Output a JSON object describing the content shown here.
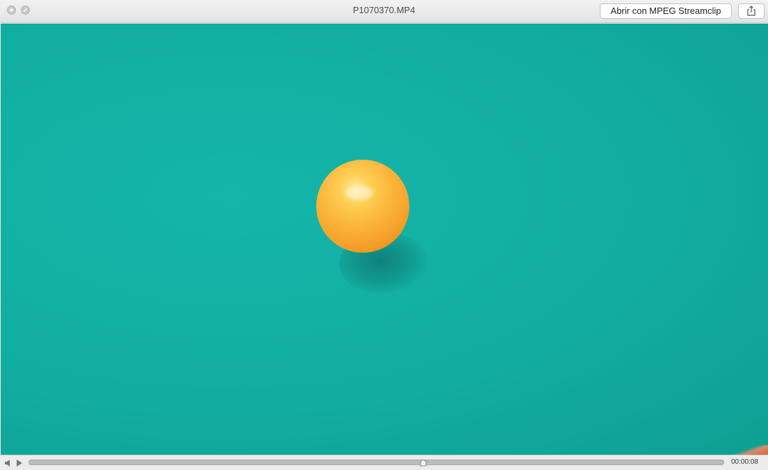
{
  "window": {
    "title": "P1070370.MP4"
  },
  "toolbar": {
    "open_with_label": "Abrir con MPEG Streamclip",
    "share_icon": "share-icon"
  },
  "traffic_lights": {
    "close_icon": "close-icon",
    "minimize_icon": "minimize-icon"
  },
  "video": {
    "background_color": "#12ada1",
    "ball_color": "#fbb43a"
  },
  "playback": {
    "current_time": "00:00:08",
    "progress": 0.567,
    "volume_icon": "speaker-icon",
    "play_icon": "play-icon"
  }
}
